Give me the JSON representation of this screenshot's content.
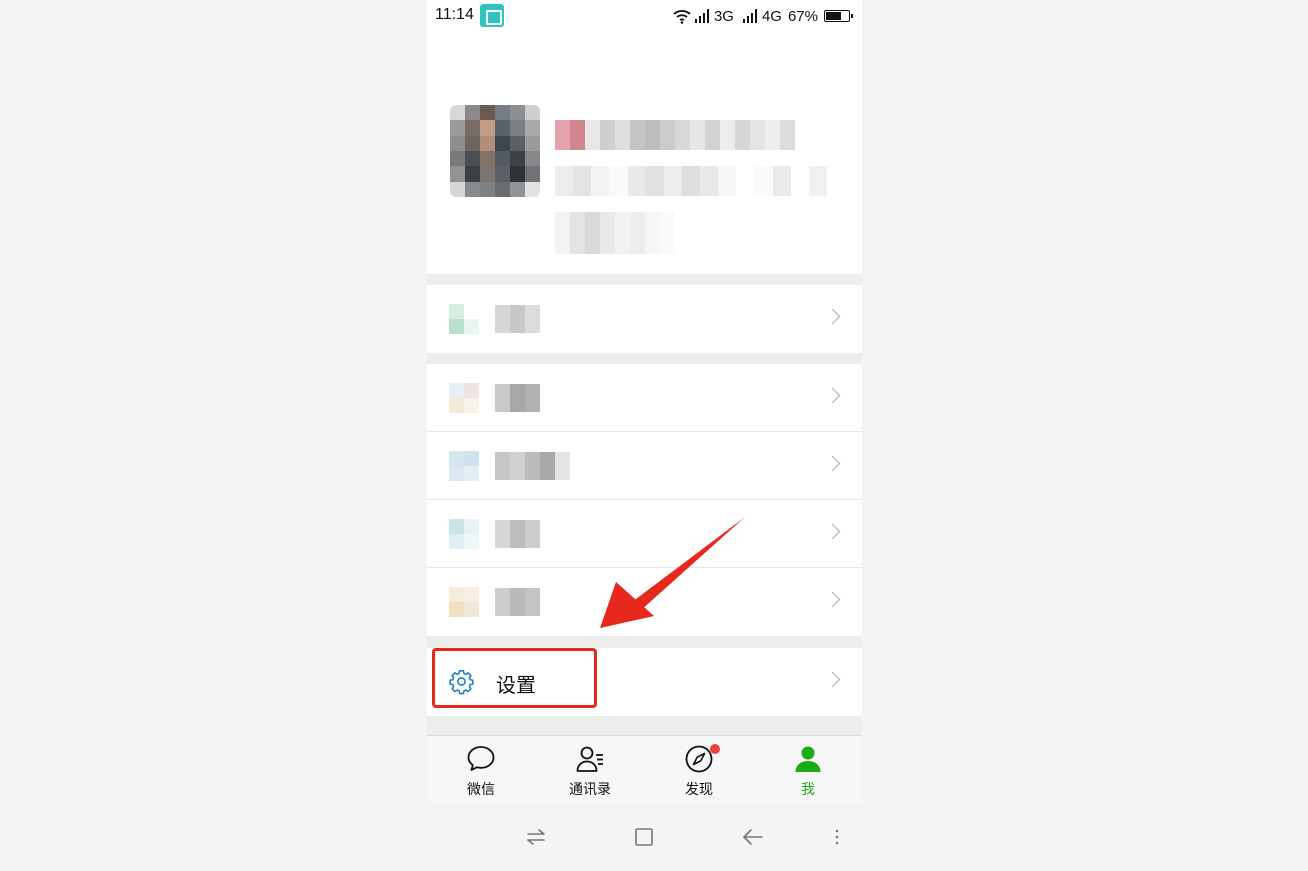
{
  "status_bar": {
    "time": "11:14",
    "net1": "3G",
    "net2": "4G",
    "battery": "67%",
    "battery_level": 0.67,
    "icons": [
      "screenshot-icon",
      "wifi-icon",
      "signal-icon",
      "signal-icon",
      "battery-icon"
    ]
  },
  "menu": {
    "settings_label": "设置"
  },
  "tabbar": {
    "tabs": [
      {
        "label": "微信",
        "icon": "chat-icon",
        "active": false
      },
      {
        "label": "通讯录",
        "icon": "contacts-icon",
        "active": false
      },
      {
        "label": "发现",
        "icon": "compass-icon",
        "active": false,
        "badge": true
      },
      {
        "label": "我",
        "icon": "person-icon",
        "active": true
      }
    ]
  },
  "colors": {
    "accent_green": "#1aad19",
    "annotation_red": "#e8281c",
    "badge_red": "#e64340"
  },
  "system_nav": {
    "icons": [
      "switch-icon",
      "home-icon",
      "back-icon",
      "menu-icon"
    ]
  }
}
